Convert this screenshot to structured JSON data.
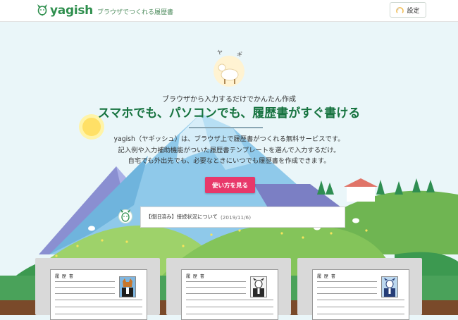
{
  "header": {
    "brand": "yagish",
    "tagline": "ブラウザでつくれる履歴書",
    "settings_label": "設定"
  },
  "hero": {
    "goat_speech": [
      "ヤ",
      "ギ"
    ],
    "tagline": "ブラウザから入力するだけでかんたん作成",
    "headline": "スマホでも、パソコンでも、履歴書がすぐ書ける",
    "description": [
      "yagish（ヤギッシュ）は、ブラウザ上で履歴書がつくれる無料サービスです。",
      "記入例や入力補助機能がついた履歴書テンプレートを選んで入力するだけ。",
      "自宅でも外出先でも、必要なときにいつでも履歴書を作成できます。"
    ],
    "cta_label": "使い方を見る"
  },
  "notice": {
    "text": "【復旧済み】接続状況について",
    "date": "(2019/11/6)"
  },
  "templates": [
    {
      "sheet_title": "履 歴 書",
      "photo_color": "#7fb6e0",
      "figure_color": "#c8762a"
    },
    {
      "sheet_title": "履 歴 書",
      "photo_color": "#f5f5f5",
      "figure_color": "#2b2b2b"
    },
    {
      "sheet_title": "履 歴 書",
      "photo_color": "#bcd8ef",
      "figure_color": "#253d77"
    }
  ],
  "colors": {
    "brand_green": "#2f8f4e",
    "headline_green": "#16733f",
    "cta_pink": "#e8386a",
    "sky": "#eaf6f9"
  }
}
